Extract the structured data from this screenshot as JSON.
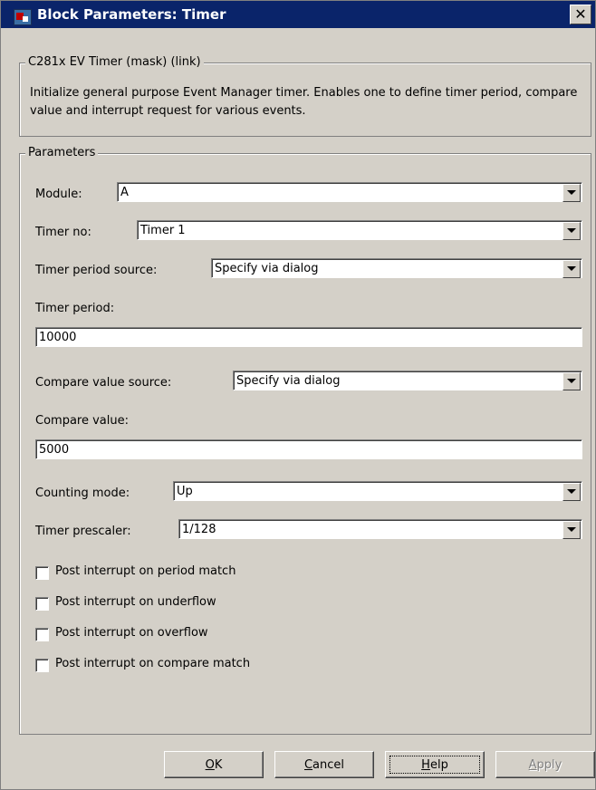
{
  "window": {
    "title": "Block Parameters: Timer",
    "close_glyph": "✕"
  },
  "mask": {
    "legend": "C281x EV Timer (mask) (link)",
    "description": "Initialize general purpose Event Manager timer. Enables one to define timer period, compare value and interrupt request for various events."
  },
  "parameters": {
    "legend": "Parameters",
    "module": {
      "label": "Module:",
      "value": "A"
    },
    "timer_no": {
      "label": "Timer no:",
      "value": "Timer 1"
    },
    "period_source": {
      "label": "Timer period source:",
      "value": "Specify via dialog"
    },
    "period": {
      "label": "Timer period:",
      "value": "10000"
    },
    "compare_source": {
      "label": "Compare value source:",
      "value": "Specify via dialog"
    },
    "compare": {
      "label": "Compare value:",
      "value": "5000"
    },
    "counting_mode": {
      "label": "Counting mode:",
      "value": "Up"
    },
    "prescaler": {
      "label": "Timer prescaler:",
      "value": "1/128"
    },
    "checkboxes": [
      {
        "label": "Post interrupt on period match",
        "checked": false
      },
      {
        "label": "Post interrupt on underflow",
        "checked": false
      },
      {
        "label": "Post interrupt on overflow",
        "checked": false
      },
      {
        "label": "Post interrupt on compare match",
        "checked": false
      }
    ]
  },
  "buttons": {
    "ok": {
      "mnemonic": "O",
      "rest": "K"
    },
    "cancel": {
      "mnemonic": "C",
      "rest": "ancel"
    },
    "help": {
      "mnemonic": "H",
      "rest": "elp"
    },
    "apply": {
      "mnemonic": "A",
      "rest": "pply"
    }
  }
}
